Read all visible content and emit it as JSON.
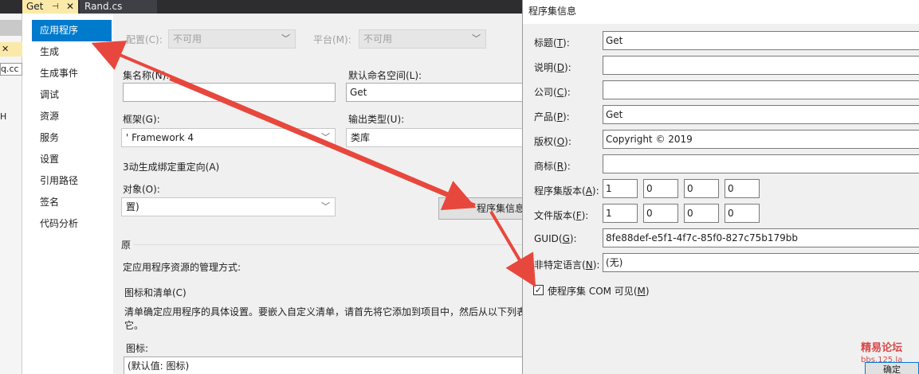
{
  "tabs": {
    "active": "Get",
    "active_pin": "⊣",
    "active_close": "✕",
    "other": "Rand.cs"
  },
  "left_strip": {
    "close": "✕",
    "file_fragment": "q.cc",
    "letter": "H"
  },
  "nav": {
    "items": [
      "应用程序",
      "生成",
      "生成事件",
      "调试",
      "资源",
      "服务",
      "设置",
      "引用路径",
      "签名",
      "代码分析"
    ]
  },
  "content": {
    "config_label": "配置(C):",
    "config_value": "不可用",
    "platform_label": "平台(M):",
    "platform_value": "不可用",
    "assembly_name_label": "集名称(N):",
    "assembly_name_value": "",
    "default_ns_label": "默认命名空间(L):",
    "default_ns_value": "Get",
    "framework_label": "框架(G):",
    "framework_value": "' Framework 4",
    "output_type_label": "输出类型(U):",
    "output_type_value": "类库",
    "auto_binding": "3动生成绑定重定向(A)",
    "startup_label": "对象(O):",
    "startup_value": "置)",
    "assembly_info_button": "程序集信息",
    "resources_header": "原",
    "resources_desc": "定应用程序资源的管理方式:",
    "icon_manifest": "图标和清单(C)",
    "manifest_desc_1": "清单确定应用程序的具体设置。要嵌入自定义清单，请首先将它添加到项目中，然后从以下列表",
    "manifest_desc_2": "它。",
    "icon_label": "图标:",
    "icon_value": "(默认值: 图标)"
  },
  "dialog": {
    "title": "程序集信息",
    "title_label": "标题",
    "title_key": "T",
    "title_value": "Get",
    "desc_label": "说明",
    "desc_key": "D",
    "desc_value": "",
    "company_label": "公司",
    "company_key": "C",
    "company_value": "",
    "product_label": "产品",
    "product_key": "P",
    "product_value": "Get",
    "copyright_label": "版权",
    "copyright_key": "O",
    "copyright_value": "Copyright ©  2019",
    "trademark_label": "商标",
    "trademark_key": "R",
    "trademark_value": "",
    "asm_version_label": "程序集版本",
    "asm_version_key": "A",
    "asm_version": [
      "1",
      "0",
      "0",
      "0"
    ],
    "file_version_label": "文件版本",
    "file_version_key": "F",
    "file_version": [
      "1",
      "0",
      "0",
      "0"
    ],
    "guid_label": "GUID",
    "guid_key": "G",
    "guid_value": "8fe88def-e5f1-4f7c-85f0-827c75b179bb",
    "neutral_lang_label": "非特定语言",
    "neutral_lang_key": "N",
    "neutral_lang_value": "(无)",
    "com_visible_label": "使程序集 COM 可见",
    "com_visible_key": "M",
    "com_visible_checked": "✓",
    "ok_button": "确定"
  },
  "watermark": {
    "line1": "精易论坛",
    "line2": "bbs.125.la"
  },
  "colors": {
    "accent": "#007acc",
    "arrow": "#e8473d",
    "tab_active": "#fbe9a9"
  }
}
